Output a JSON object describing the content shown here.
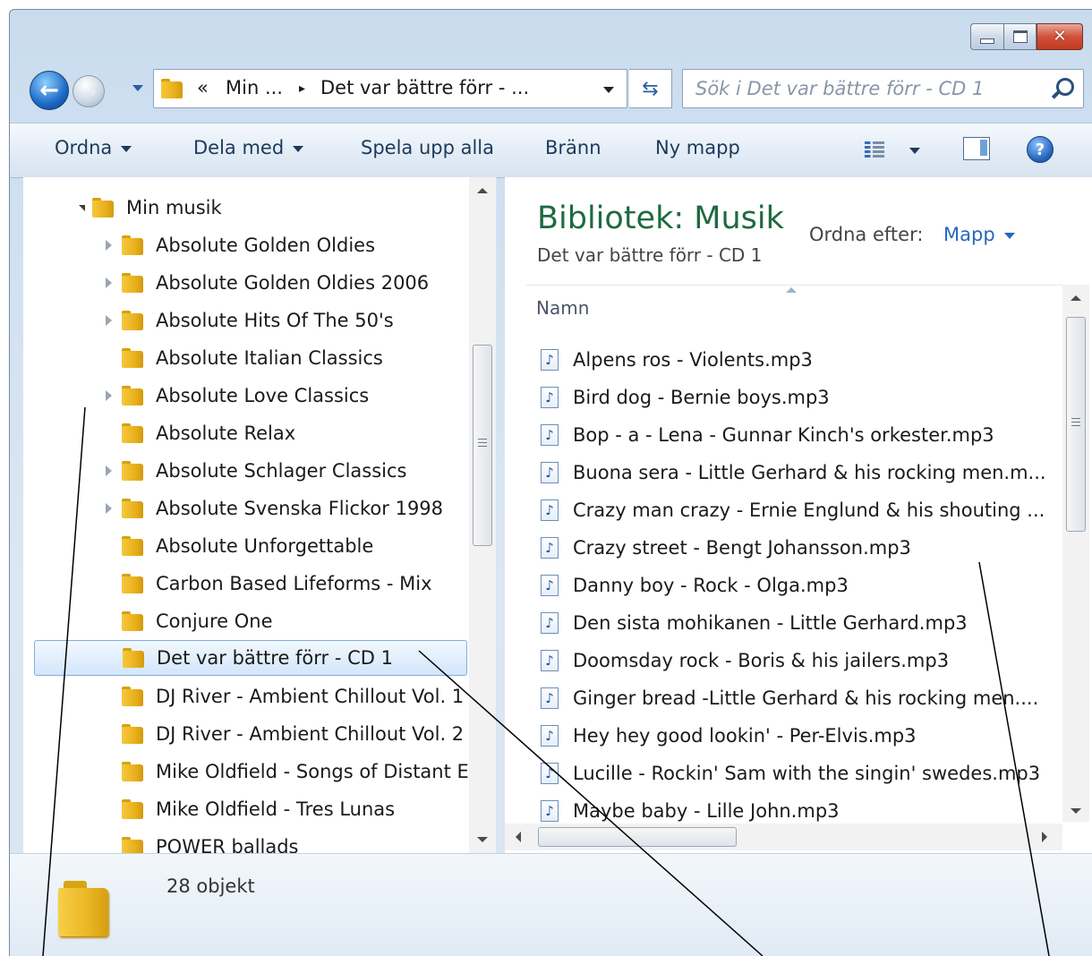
{
  "window": {
    "caption_buttons": {
      "minimize_icon": "minimize-icon",
      "maximize_icon": "maximize-icon",
      "close_glyph": "✕"
    }
  },
  "navigation": {
    "back_glyph": "←",
    "forward_glyph": "→",
    "address": {
      "overflow": "«",
      "crumb1": "Min ...",
      "separator": "▸",
      "crumb2": "Det var bättre förr - ..."
    },
    "refresh_glyph": "⇆",
    "search_placeholder": "Sök i Det var bättre förr - CD 1"
  },
  "toolbar": {
    "organize": "Ordna",
    "share": "Dela med",
    "play_all": "Spela upp alla",
    "burn": "Bränn",
    "new_folder": "Ny mapp",
    "help_glyph": "?"
  },
  "tree": {
    "root": "Min musik",
    "items": [
      {
        "label": "Absolute Golden Oldies",
        "expandable": true
      },
      {
        "label": "Absolute Golden Oldies 2006",
        "expandable": true
      },
      {
        "label": "Absolute Hits Of The 50's",
        "expandable": true
      },
      {
        "label": "Absolute Italian Classics",
        "expandable": false
      },
      {
        "label": "Absolute Love Classics",
        "expandable": true
      },
      {
        "label": "Absolute Relax",
        "expandable": false
      },
      {
        "label": "Absolute Schlager Classics",
        "expandable": true
      },
      {
        "label": "Absolute Svenska Flickor 1998",
        "expandable": true
      },
      {
        "label": "Absolute Unforgettable",
        "expandable": false
      },
      {
        "label": "Carbon Based Lifeforms - Mix",
        "expandable": false
      },
      {
        "label": "Conjure One",
        "expandable": false
      },
      {
        "label": "Det var bättre förr - CD 1",
        "expandable": false,
        "selected": true
      },
      {
        "label": "DJ River - Ambient Chillout Vol. 1",
        "expandable": false
      },
      {
        "label": "DJ River - Ambient Chillout Vol. 2",
        "expandable": false
      },
      {
        "label": "Mike Oldfield - Songs of Distant E",
        "expandable": false
      },
      {
        "label": "Mike Oldfield - Tres Lunas",
        "expandable": false
      },
      {
        "label": "POWER ballads",
        "expandable": false
      }
    ]
  },
  "library": {
    "title": "Bibliotek: Musik",
    "subtitle": "Det var bättre förr - CD 1",
    "arrange_label": "Ordna efter:",
    "arrange_value": "Mapp"
  },
  "columns": {
    "name": "Namn"
  },
  "files": [
    "Alpens ros - Violents.mp3",
    "Bird dog - Bernie boys.mp3",
    "Bop - a - Lena - Gunnar Kinch's orkester.mp3",
    "Buona sera - Little Gerhard & his rocking men.m...",
    "Crazy man crazy - Ernie Englund & his shouting ...",
    "Crazy street - Bengt Johansson.mp3",
    "Danny boy - Rock - Olga.mp3",
    "Den sista mohikanen - Little Gerhard.mp3",
    "Doomsday rock  - Boris & his jailers.mp3",
    "Ginger bread -Little Gerhard & his rocking men....",
    "Hey hey good lookin' - Per-Elvis.mp3",
    "Lucille - Rockin' Sam with the singin' swedes.mp3",
    "Maybe baby - Lille John.mp3"
  ],
  "details": {
    "count": "28 objekt"
  },
  "colors": {
    "accent": "#1e6b3f",
    "link": "#2a66c0",
    "selection": "#d3e6fb",
    "folder": "#eab11d"
  }
}
